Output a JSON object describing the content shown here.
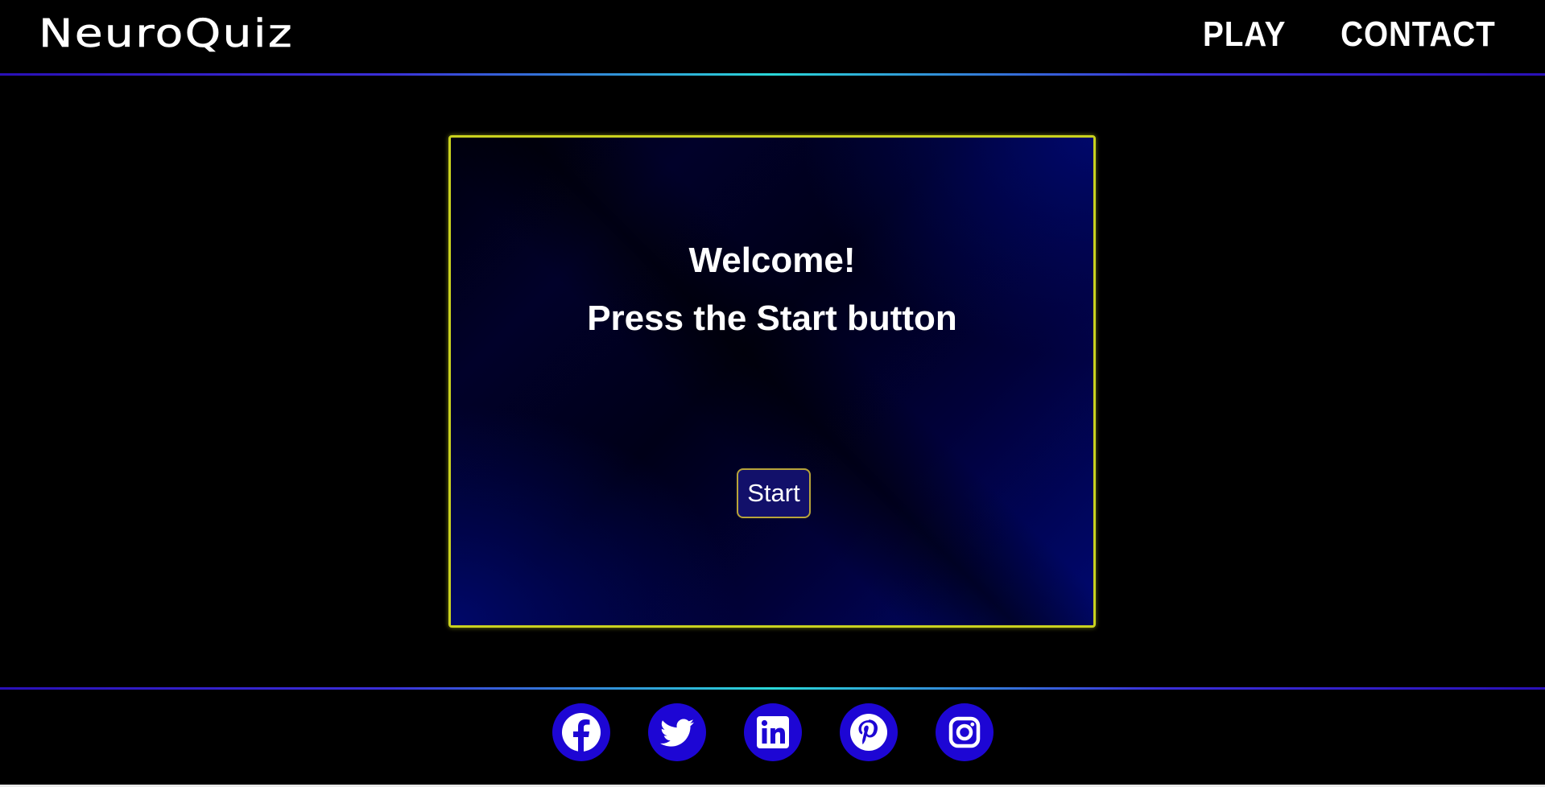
{
  "header": {
    "logo": "NeuroQuiz",
    "nav": [
      {
        "label": "PLAY"
      },
      {
        "label": "CONTACT"
      }
    ]
  },
  "card": {
    "title_line1": "Welcome!",
    "title_line2": "Press the Start button",
    "start_label": "Start"
  },
  "footer": {
    "socials": [
      {
        "icon": "facebook-icon"
      },
      {
        "icon": "twitter-icon"
      },
      {
        "icon": "linkedin-icon"
      },
      {
        "icon": "pinterest-icon"
      },
      {
        "icon": "instagram-icon"
      }
    ]
  },
  "colors": {
    "background": "#000000",
    "card_border": "#c9d21f",
    "social_circle": "#1d06d4",
    "glow_center": "#2ad8d8",
    "glow_edge": "#2a10b8"
  }
}
